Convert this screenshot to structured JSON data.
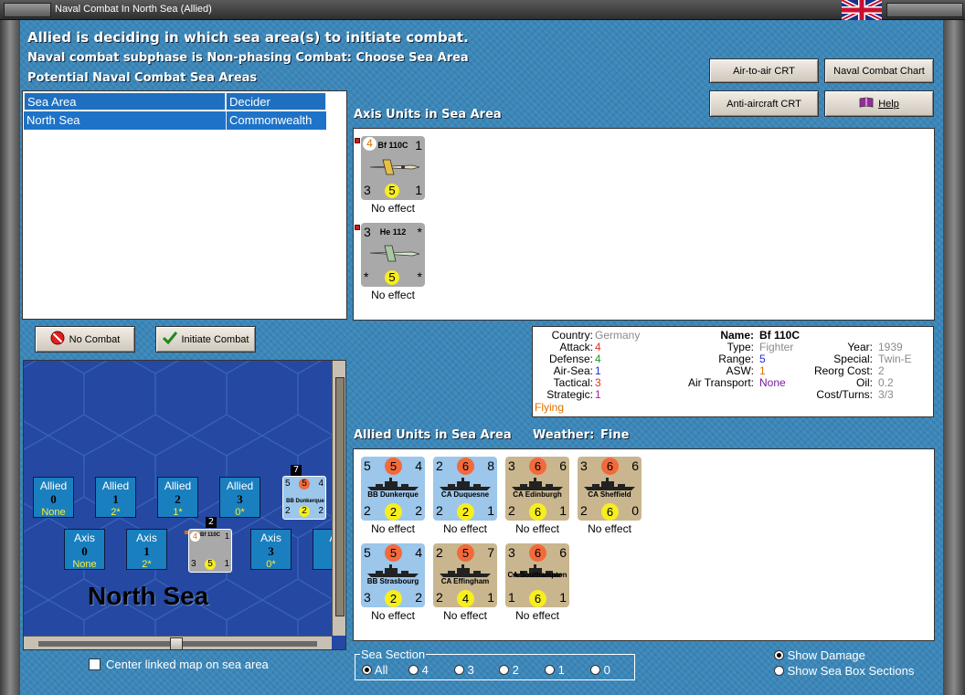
{
  "window": {
    "title": "Naval Combat In North Sea (Allied)"
  },
  "header": {
    "line1": "Allied is deciding in which sea area(s) to initiate combat.",
    "line2": "Naval combat subphase is Non-phasing Combat: Choose Sea Area",
    "line3": "Potential Naval Combat Sea Areas"
  },
  "buttons": {
    "air_to_air": "Air-to-air CRT",
    "naval_chart": "Naval Combat Chart",
    "anti_aircraft": "Anti-aircraft CRT",
    "help": "Help",
    "no_combat": "No Combat",
    "initiate": "Initiate Combat"
  },
  "sea_table": {
    "headers": [
      "Sea Area",
      "Decider"
    ],
    "rows": [
      {
        "area": "North Sea",
        "decider": "Commonwealth"
      }
    ]
  },
  "axis_panel": {
    "title": "Axis Units in Sea Area",
    "units": [
      {
        "name": "Bf 110C",
        "tl": "4",
        "tr": "1",
        "bl": "3",
        "bc": "5",
        "br": "1",
        "effect": "No effect"
      },
      {
        "name": "He 112",
        "tl": "3",
        "tr": "*",
        "bl": "*",
        "bc": "5",
        "br": "*",
        "effect": "No effect"
      }
    ]
  },
  "info": {
    "country_label": "Country:",
    "country": "Germany",
    "attack_label": "Attack:",
    "attack": "4",
    "defense_label": "Defense:",
    "defense": "4",
    "airsea_label": "Air-Sea:",
    "airsea": "1",
    "tactical_label": "Tactical:",
    "tactical": "3",
    "strategic_label": "Strategic:",
    "strategic": "1",
    "flying": "Flying",
    "name_label": "Name:",
    "name": "Bf 110C",
    "type_label": "Type:",
    "type": "Fighter",
    "range_label": "Range:",
    "range": "5",
    "asw_label": "ASW:",
    "asw": "1",
    "airtransport_label": "Air Transport:",
    "airtransport": "None",
    "year_label": "Year:",
    "year": "1939",
    "special_label": "Special:",
    "special": "Twin-E",
    "reorg_label": "Reorg Cost:",
    "reorg": "2",
    "oil_label": "Oil:",
    "oil": "0.2",
    "cost_label": "Cost/Turns:",
    "cost": "3/3"
  },
  "allied_panel": {
    "title": "Allied Units in Sea Area",
    "weather_label": "Weather:",
    "weather": "Fine",
    "units": [
      {
        "name": "BB Dunkerque",
        "tl": "5",
        "tc": "5",
        "tr": "4",
        "bl": "2",
        "bc": "2",
        "br": "2",
        "effect": "No effect",
        "color": "blue"
      },
      {
        "name": "CA Duquesne",
        "tl": "2",
        "tc": "6",
        "tr": "8",
        "bl": "2",
        "bc": "2",
        "br": "1",
        "effect": "No effect",
        "color": "blue"
      },
      {
        "name": "CA Edinburgh",
        "tl": "3",
        "tc": "6",
        "tr": "6",
        "bl": "2",
        "bc": "6",
        "br": "1",
        "effect": "No effect",
        "color": "tan"
      },
      {
        "name": "CA Sheffield",
        "tl": "3",
        "tc": "6",
        "tr": "6",
        "bl": "2",
        "bc": "6",
        "br": "0",
        "effect": "No effect",
        "color": "tan"
      },
      {
        "name": "BB Strasbourg",
        "tl": "5",
        "tc": "5",
        "tr": "4",
        "bl": "3",
        "bc": "2",
        "br": "2",
        "effect": "No effect",
        "color": "blue"
      },
      {
        "name": "CA Effingham",
        "tl": "2",
        "tc": "5",
        "tr": "7",
        "bl": "2",
        "bc": "4",
        "br": "1",
        "effect": "No effect",
        "color": "tan"
      },
      {
        "name": "CA Southampton",
        "tl": "3",
        "tc": "6",
        "tr": "6",
        "bl": "1",
        "bc": "6",
        "br": "1",
        "effect": "No effect",
        "color": "tan"
      }
    ]
  },
  "map": {
    "sea_name": "North Sea",
    "allied_boxes": [
      {
        "label": "Allied",
        "num": "0",
        "sub": "None"
      },
      {
        "label": "Allied",
        "num": "1",
        "sub": "2*"
      },
      {
        "label": "Allied",
        "num": "2",
        "sub": "1*"
      },
      {
        "label": "Allied",
        "num": "3",
        "sub": "0*"
      }
    ],
    "axis_boxes": [
      {
        "label": "Axis",
        "num": "0",
        "sub": "None"
      },
      {
        "label": "Axis",
        "num": "1",
        "sub": "2*"
      },
      {
        "label": "Axis",
        "num": "3",
        "sub": "0*"
      },
      {
        "label": "A"
      }
    ],
    "stack_allied": {
      "count": "7",
      "name": "BB Dunkerque",
      "tl": "5",
      "tc": "5",
      "tr": "4",
      "bl": "2",
      "bc": "2",
      "br": "2"
    },
    "stack_axis": {
      "count": "2",
      "name": "Bf 110C",
      "tl": "4",
      "tr": "1",
      "bl": "3",
      "bc": "5",
      "br": "1"
    },
    "center_checkbox": "Center linked map on sea area"
  },
  "sea_section": {
    "legend": "Sea Section",
    "options": [
      "All",
      "4",
      "3",
      "2",
      "1",
      "0"
    ],
    "selected": "All"
  },
  "view_options": {
    "show_damage": "Show Damage",
    "show_sections": "Show Sea Box Sections",
    "selected": "show_damage"
  },
  "colors": {
    "attack": "#e0301e",
    "defense": "#1a9a2a",
    "airsea": "#1a2fd0",
    "tactical": "#e0301e",
    "strategic": "#b01ab0",
    "flying": "#e07000",
    "grey_value": "#8a8a8a",
    "asw": "#e07000",
    "airtransport": "#7a1aa0"
  }
}
